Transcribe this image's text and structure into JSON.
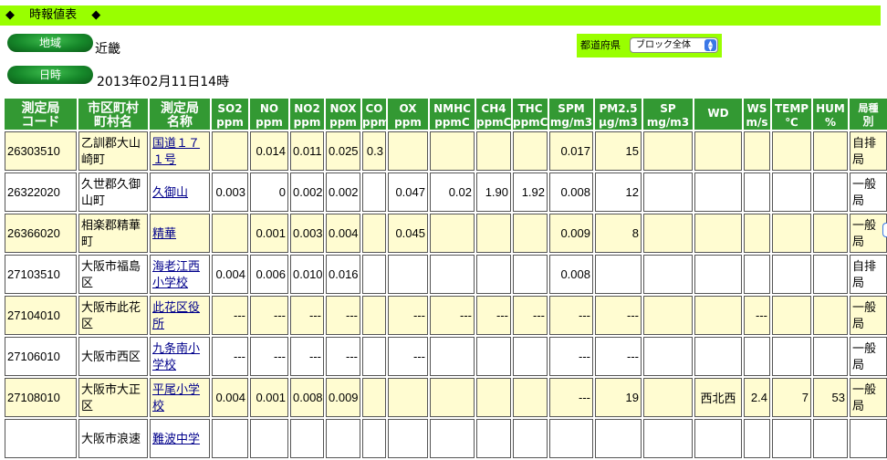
{
  "title_bar": {
    "left_diamond": "◆",
    "title": "時報値表",
    "right_diamond": "◆"
  },
  "region": {
    "label": "地域",
    "value": "近畿"
  },
  "datetime": {
    "label": "日時",
    "value": "2013年02月11日14時"
  },
  "prefecture": {
    "label": "都道府県",
    "selected": "ブロック全体"
  },
  "table": {
    "headers": [
      "測定局コード",
      "市区町村名",
      "測定局名称",
      "SO2",
      "NO",
      "NO2",
      "NOX",
      "CO",
      "OX",
      "NMHC",
      "CH4",
      "THC",
      "SPM",
      "PM2.5",
      "SP",
      "WD",
      "WS",
      "TEMP",
      "HUM",
      "局種別"
    ],
    "headers_line1": [
      "測定局",
      "市区町村",
      "測定局",
      "SO2",
      "NO",
      "NO2",
      "NOX",
      "CO",
      "OX",
      "NMHC",
      "CH4",
      "THC",
      "SPM",
      "PM2.5",
      "SP",
      "WD",
      "WS",
      "TEMP",
      "HUM",
      "局種"
    ],
    "headers_line2": [
      "コード",
      "町村名",
      "名称",
      "ppm",
      "ppm",
      "ppm",
      "ppm",
      "ppm",
      "ppm",
      "ppmC",
      "ppmC",
      "ppmC",
      "mg/m3",
      "μg/m3",
      "mg/m3",
      "",
      "m/s",
      "℃",
      "%",
      "別"
    ],
    "rows": [
      [
        "26303510",
        "乙訓郡大山崎町",
        "国道１７１号",
        "",
        "0.014",
        "0.011",
        "0.025",
        "0.3",
        "",
        "",
        "",
        "",
        "0.017",
        "15",
        "",
        "",
        "",
        "",
        "",
        "自排局"
      ],
      [
        "26322020",
        "久世郡久御山町",
        "久御山",
        "0.003",
        "0",
        "0.002",
        "0.002",
        "",
        "0.047",
        "0.02",
        "1.90",
        "1.92",
        "0.008",
        "12",
        "",
        "",
        "",
        "",
        "",
        "一般局"
      ],
      [
        "26366020",
        "相楽郡精華町",
        "精華",
        "",
        "0.001",
        "0.003",
        "0.004",
        "",
        "0.045",
        "",
        "",
        "",
        "0.009",
        "8",
        "",
        "",
        "",
        "",
        "",
        "一般局"
      ],
      [
        "27103510",
        "大阪市福島区",
        "海老江西小学校",
        "0.004",
        "0.006",
        "0.010",
        "0.016",
        "",
        "",
        "",
        "",
        "",
        "0.008",
        "",
        "",
        "",
        "",
        "",
        "",
        "自排局"
      ],
      [
        "27104010",
        "大阪市此花区",
        "此花区役所",
        "---",
        "---",
        "---",
        "---",
        "",
        "---",
        "---",
        "---",
        "---",
        "---",
        "---",
        "",
        "",
        "---",
        "",
        "",
        "一般局"
      ],
      [
        "27106010",
        "大阪市西区",
        "九条南小学校",
        "---",
        "---",
        "---",
        "---",
        "",
        "---",
        "",
        "",
        "",
        "---",
        "---",
        "",
        "",
        "",
        "",
        "",
        "一般局"
      ],
      [
        "27108010",
        "大阪市大正区",
        "平尾小学校",
        "0.004",
        "0.001",
        "0.008",
        "0.009",
        "",
        "",
        "",
        "",
        "",
        "---",
        "19",
        "",
        "西北西",
        "2.4",
        "7",
        "53",
        "一般局"
      ],
      [
        "",
        "大阪市浪速",
        "難波中学",
        "",
        "",
        "",
        "",
        "",
        "",
        "",
        "",
        "",
        "",
        "",
        "",
        "",
        "",
        "",
        "",
        ""
      ]
    ]
  }
}
